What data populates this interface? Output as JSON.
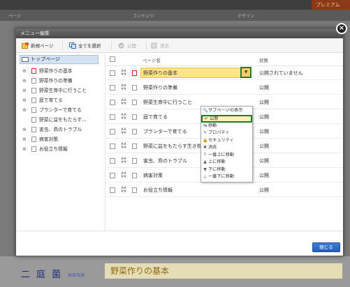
{
  "background": {
    "premium_label": "プレミアム",
    "nav_items": [
      "ページ",
      "コンテンツ",
      "デザイン"
    ],
    "bottom_title": "野菜作りの基本",
    "bottom_kanji": [
      "二",
      "庭",
      "菌"
    ],
    "bottom_small": "病害虫害"
  },
  "modal": {
    "title": "メニュー編集",
    "toolbar": {
      "new_page": "新規ページ",
      "select_all": "全てを選択",
      "publish": "公開",
      "delete": "消去"
    },
    "tree": {
      "root": "トップページ",
      "items": [
        {
          "label": "野菜作りの基本",
          "expander": "⊕",
          "red": true
        },
        {
          "label": "野菜作りの準備",
          "expander": "⊕",
          "red": false
        },
        {
          "label": "野菜生育中に行うこと",
          "expander": "⊕",
          "red": false
        },
        {
          "label": "庭で育てる",
          "expander": "⊕",
          "red": false
        },
        {
          "label": "プランターで育てる",
          "expander": "⊕",
          "red": false
        },
        {
          "label": "野菜に益をもたらす…",
          "expander": "",
          "red": false
        },
        {
          "label": "害虫、鳥のトラブル",
          "expander": "⊕",
          "red": false
        },
        {
          "label": "病害対策",
          "expander": "⊕",
          "red": false
        },
        {
          "label": "お役立ち情報",
          "expander": "⊕",
          "red": false
        }
      ]
    },
    "table": {
      "col_name": "ページ名",
      "col_status": "状態",
      "rows": [
        {
          "name": "野菜作りの基本",
          "status": "公開されていません"
        },
        {
          "name": "野菜作りの準備",
          "status": "公開"
        },
        {
          "name": "野菜生育中に行うこと",
          "status": "公開"
        },
        {
          "name": "庭で育てる",
          "status": "公開"
        },
        {
          "name": "プランターで育てる",
          "status": "公開"
        },
        {
          "name": "野菜に益をもたらす生き物",
          "status": "公開"
        },
        {
          "name": "害虫、鳥のトラブル",
          "status": "公開"
        },
        {
          "name": "病害対策",
          "status": "公開"
        },
        {
          "name": "お役立ち情報",
          "status": "公開"
        }
      ]
    },
    "context_menu": [
      {
        "icon": "🔍",
        "label": "サブページの表示"
      },
      {
        "icon": "✔",
        "label": "公開"
      },
      {
        "icon": "↹",
        "label": "移動"
      },
      {
        "icon": "✎",
        "label": "プロパティ"
      },
      {
        "icon": "🔒",
        "label": "セキュリティ"
      },
      {
        "icon": "✖",
        "label": "消去"
      },
      {
        "icon": "⤒",
        "label": "一番上に移動"
      },
      {
        "icon": "▲",
        "label": "上に移動"
      },
      {
        "icon": "▼",
        "label": "下に移動"
      },
      {
        "icon": "⤓",
        "label": "一番下に移動"
      }
    ],
    "close_button": "閉じる"
  },
  "colors": {
    "highlight": "#ffe58a",
    "selected_outline": "#1f7a2a",
    "primary_button": "#2f6fc6"
  }
}
